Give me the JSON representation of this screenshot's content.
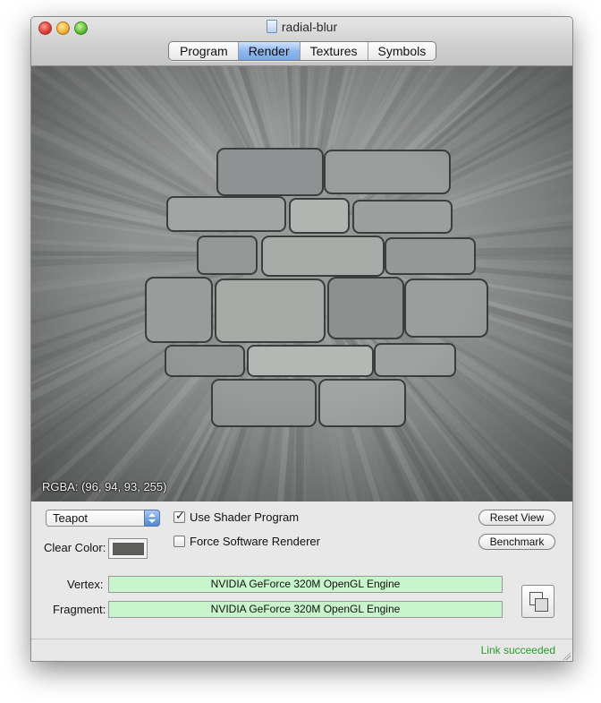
{
  "window": {
    "title": "radial-blur"
  },
  "tabs": [
    {
      "label": "Program",
      "selected": false
    },
    {
      "label": "Render",
      "selected": true
    },
    {
      "label": "Textures",
      "selected": false
    },
    {
      "label": "Symbols",
      "selected": false
    }
  ],
  "viewport": {
    "rgba_readout": "RGBA: (96, 94, 93, 255)"
  },
  "controls": {
    "model_popup": {
      "selected": "Teapot"
    },
    "clear_color": {
      "label": "Clear Color:",
      "swatch_color": "#5e5e5d"
    },
    "use_shader_program": {
      "label": "Use Shader Program",
      "checked": true
    },
    "force_software_renderer": {
      "label": "Force Software Renderer",
      "checked": false
    },
    "reset_view_label": "Reset View",
    "benchmark_label": "Benchmark"
  },
  "engines": {
    "vertex_label": "Vertex:",
    "vertex_value": "NVIDIA GeForce 320M OpenGL Engine",
    "fragment_label": "Fragment:",
    "fragment_value": "NVIDIA GeForce 320M OpenGL Engine",
    "status_color": "#c8f5cc"
  },
  "status": {
    "text": "Link succeeded",
    "color": "#2b9a2b"
  }
}
